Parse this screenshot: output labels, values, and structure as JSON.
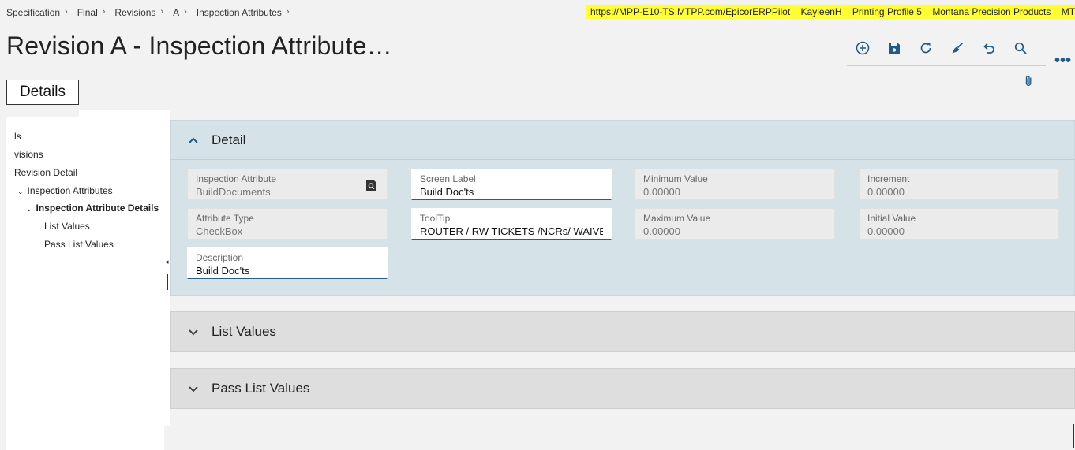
{
  "breadcrumb": [
    "Specification",
    "Final",
    "Revisions",
    "A",
    "Inspection Attributes"
  ],
  "infobar": {
    "url": "https://MPP-E10-TS.MTPP.com/EpicorERPPilot",
    "user": "KayleenH",
    "printing_profile": "Printing Profile 5",
    "company": "Montana Precision Products",
    "site": "MTPP Main Site"
  },
  "page_title": "Revision A - Inspection Attribute…",
  "details_tab": "Details",
  "toolbar": {
    "icons": [
      "add-icon",
      "save-icon",
      "refresh-icon",
      "clear-icon",
      "undo-icon",
      "search-icon"
    ],
    "more": "•••"
  },
  "tree": {
    "items": [
      {
        "label": "ls",
        "level": 0
      },
      {
        "label": "visions",
        "level": 0
      },
      {
        "label": "Revision Detail",
        "level": 0
      },
      {
        "label": "Inspection Attributes",
        "level": 1,
        "expanded": true
      },
      {
        "label": "Inspection Attribute Details",
        "level": 2,
        "expanded": true,
        "selected": true
      },
      {
        "label": "List Values",
        "level": 3
      },
      {
        "label": "Pass List Values",
        "level": 3
      }
    ]
  },
  "detail_panel": {
    "title": "Detail",
    "fields": {
      "inspection_attribute": {
        "label": "Inspection Attribute",
        "value": "BuildDocuments"
      },
      "screen_label": {
        "label": "Screen Label",
        "value": "Build Doc'ts"
      },
      "minimum_value": {
        "label": "Minimum Value",
        "value": "0.00000"
      },
      "increment": {
        "label": "Increment",
        "value": "0.00000"
      },
      "attribute_type": {
        "label": "Attribute Type",
        "value": "CheckBox"
      },
      "tooltip": {
        "label": "ToolTip",
        "value": "ROUTER / RW TICKETS /NCRs/ WAIVERS ,"
      },
      "maximum_value": {
        "label": "Maximum Value",
        "value": "0.00000"
      },
      "initial_value": {
        "label": "Initial Value",
        "value": "0.00000"
      },
      "description": {
        "label": "Description",
        "value": "Build Doc'ts"
      }
    }
  },
  "list_values_panel": {
    "title": "List Values"
  },
  "pass_list_values_panel": {
    "title": "Pass List Values"
  }
}
